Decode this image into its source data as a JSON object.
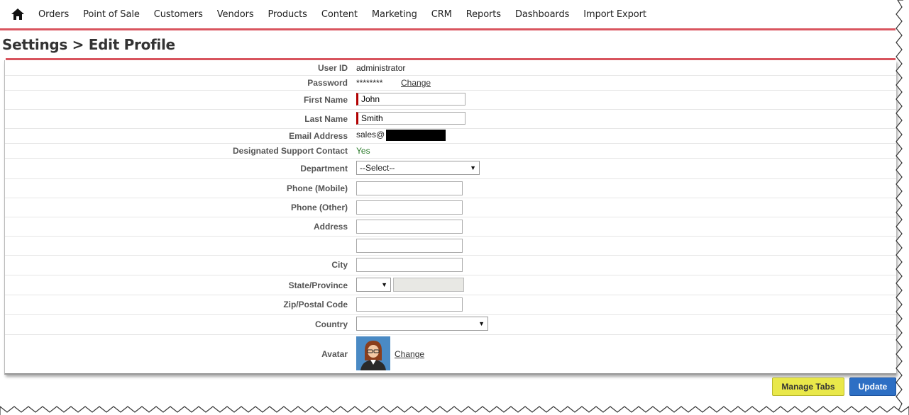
{
  "nav": {
    "items": [
      "Orders",
      "Point of Sale",
      "Customers",
      "Vendors",
      "Products",
      "Content",
      "Marketing",
      "CRM",
      "Reports",
      "Dashboards",
      "Import Export"
    ]
  },
  "page": {
    "title": "Settings > Edit Profile"
  },
  "form": {
    "user_id": {
      "label": "User ID",
      "value": "administrator"
    },
    "password": {
      "label": "Password",
      "value": "********",
      "change": "Change"
    },
    "first_name": {
      "label": "First Name",
      "value": "John"
    },
    "last_name": {
      "label": "Last Name",
      "value": "Smith"
    },
    "email": {
      "label": "Email Address",
      "value": "sales@"
    },
    "support": {
      "label": "Designated Support Contact",
      "value": "Yes"
    },
    "department": {
      "label": "Department",
      "value": "--Select--"
    },
    "phone_mobile": {
      "label": "Phone (Mobile)",
      "value": ""
    },
    "phone_other": {
      "label": "Phone (Other)",
      "value": ""
    },
    "address": {
      "label": "Address",
      "value": "",
      "value2": ""
    },
    "city": {
      "label": "City",
      "value": ""
    },
    "state": {
      "label": "State/Province",
      "value": ""
    },
    "zip": {
      "label": "Zip/Postal Code",
      "value": ""
    },
    "country": {
      "label": "Country",
      "value": ""
    },
    "avatar": {
      "label": "Avatar",
      "change": "Change"
    }
  },
  "buttons": {
    "manage_tabs": "Manage Tabs",
    "update": "Update"
  },
  "colors": {
    "accent_rule": "#d9555f",
    "required": "#b20000",
    "update_button": "#2d6fc4",
    "tabs_button": "#e9e84a",
    "yes_text": "#2a7a2a"
  }
}
